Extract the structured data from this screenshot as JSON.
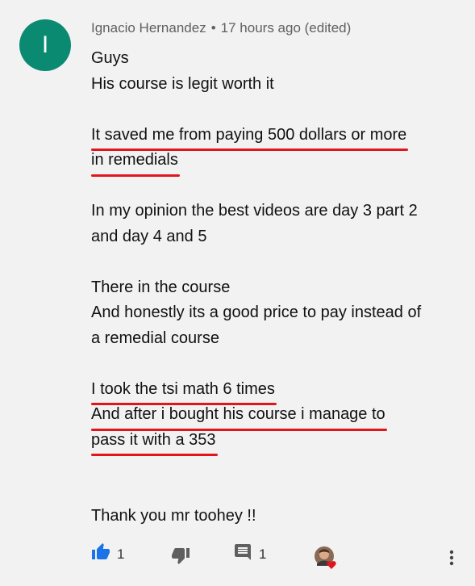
{
  "comment": {
    "author_initial": "I",
    "author": "Ignacio Hernandez",
    "separator": "•",
    "timestamp": "17 hours ago (edited)",
    "lines": [
      {
        "text": "Guys",
        "underline": false
      },
      {
        "text": "His course is legit worth it",
        "underline": false
      },
      {
        "text": "",
        "underline": false
      },
      {
        "text": "It saved me from paying 500 dollars or more",
        "underline": true
      },
      {
        "text": "in remedials",
        "underline": true
      },
      {
        "text": "",
        "underline": false
      },
      {
        "text": "In my opinion the best videos are day 3 part 2",
        "underline": false
      },
      {
        "text": "and day 4 and 5",
        "underline": false
      },
      {
        "text": "",
        "underline": false
      },
      {
        "text": "There in the course",
        "underline": false
      },
      {
        "text": "And honestly its a good price to pay instead of",
        "underline": false
      },
      {
        "text": "a remedial course",
        "underline": false
      },
      {
        "text": "",
        "underline": false
      },
      {
        "text": "I took the tsi math 6 times",
        "underline": true
      },
      {
        "text": "And after i bought his course i manage to",
        "underline": true
      },
      {
        "text": "pass it with a 353",
        "underline": true
      },
      {
        "text": "",
        "underline": false
      },
      {
        "text": "",
        "underline": false
      },
      {
        "text": "Thank you mr toohey !!",
        "underline": false
      }
    ]
  },
  "actions": {
    "like_count": "1",
    "reply_count": "1",
    "like_icon": "thumbs-up-icon",
    "dislike_icon": "thumbs-down-icon",
    "reply_icon": "comment-icon",
    "creator_heart": "creator-heart-icon",
    "more_icon": "more-vert-icon"
  },
  "colors": {
    "avatar_bg": "#0b8a72",
    "like_active": "#1a73e8",
    "underline": "#e0161b",
    "heart": "#e0161b"
  }
}
